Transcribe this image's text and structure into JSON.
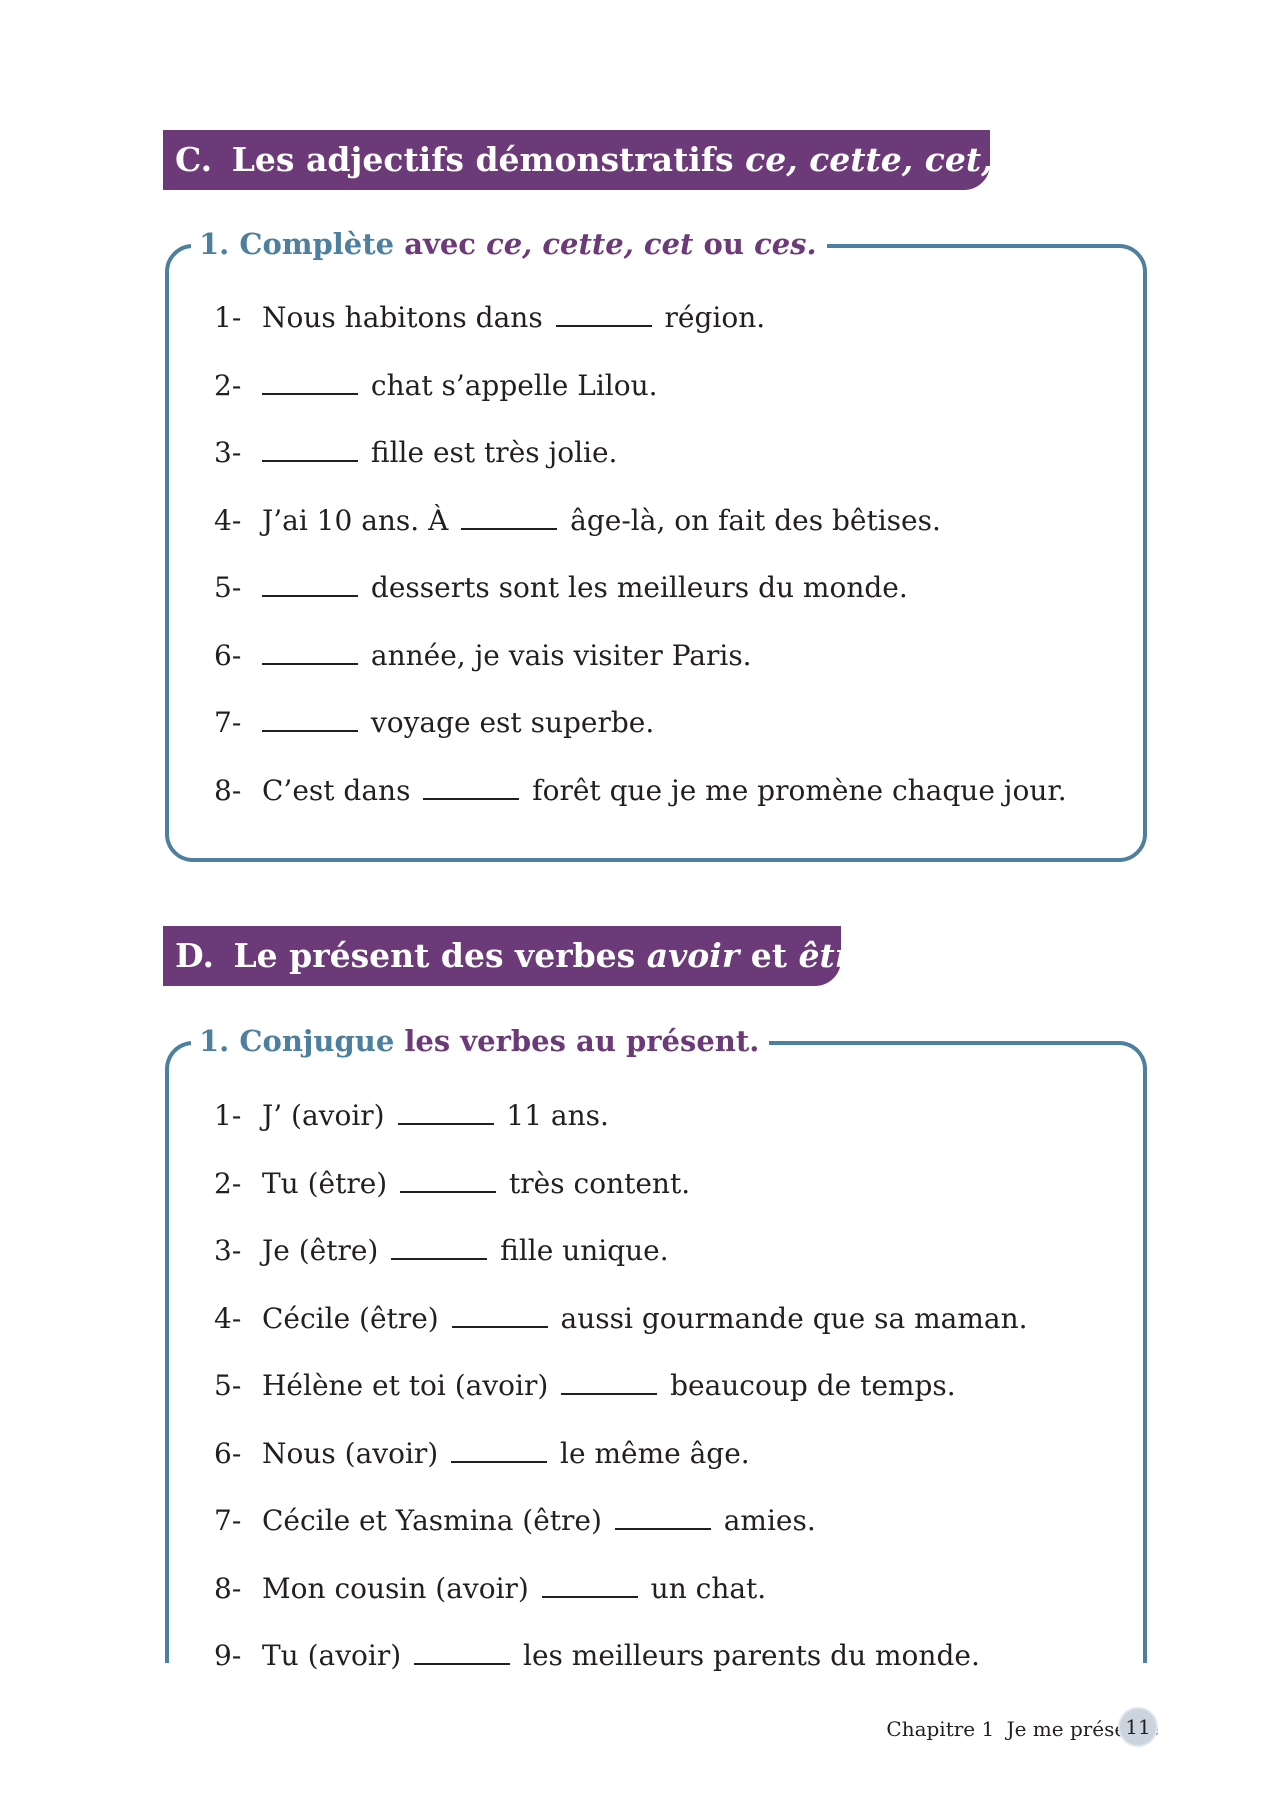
{
  "section_c": {
    "letter": "C.",
    "title_plain": "Les adjectifs démonstratifs",
    "title_italic": "ce, cette, cet, ces",
    "exercise": {
      "number": "1.",
      "verb": "Complète",
      "rest": "avec",
      "italic": "ce, cette, cet",
      "connector": "ou",
      "italic2": "ces."
    },
    "items": [
      {
        "n": "1-",
        "before": "Nous habitons dans",
        "after": "région."
      },
      {
        "n": "2-",
        "before": "",
        "after": "chat s’appelle Lilou."
      },
      {
        "n": "3-",
        "before": "",
        "after": "fille est très jolie."
      },
      {
        "n": "4-",
        "before": "J’ai 10 ans. À",
        "after": "âge-là, on fait des bêtises."
      },
      {
        "n": "5-",
        "before": "",
        "after": "desserts sont les meilleurs du monde."
      },
      {
        "n": "6-",
        "before": "",
        "after": "année, je vais visiter Paris."
      },
      {
        "n": "7-",
        "before": "",
        "after": "voyage est superbe."
      },
      {
        "n": "8-",
        "before": "C’est dans",
        "after": "forêt que je me promène chaque jour."
      }
    ]
  },
  "section_d": {
    "letter": "D.",
    "title_plain": "Le présent des verbes",
    "title_italic1": "avoir",
    "title_mid": "et",
    "title_italic2": "être",
    "exercise": {
      "number": "1.",
      "verb": "Conjugue",
      "rest": "les verbes au présent."
    },
    "items": [
      {
        "n": "1-",
        "before": "J’ (avoir)",
        "after": "11 ans."
      },
      {
        "n": "2-",
        "before": "Tu (être)",
        "after": "très content."
      },
      {
        "n": "3-",
        "before": "Je (être)",
        "after": "fille unique."
      },
      {
        "n": "4-",
        "before": "Cécile (être)",
        "after": "aussi gourmande que sa maman."
      },
      {
        "n": "5-",
        "before": "Hélène et toi (avoir)",
        "after": "beaucoup de temps."
      },
      {
        "n": "6-",
        "before": "Nous (avoir)",
        "after": "le même âge."
      },
      {
        "n": "7-",
        "before": "Cécile et Yasmina (être)",
        "after": "amies."
      },
      {
        "n": "8-",
        "before": "Mon cousin (avoir)",
        "after": "un chat."
      },
      {
        "n": "9-",
        "before": "Tu (avoir)",
        "after": "les meilleurs parents du monde."
      }
    ]
  },
  "footer": {
    "chapter": "Chapitre 1",
    "title": "Je me présente",
    "page": "11"
  },
  "colors": {
    "banner": "#6c3a78",
    "box_border": "#4d7f9e",
    "exercise_verb": "#4d7f9e",
    "exercise_text": "#6c3a78"
  }
}
